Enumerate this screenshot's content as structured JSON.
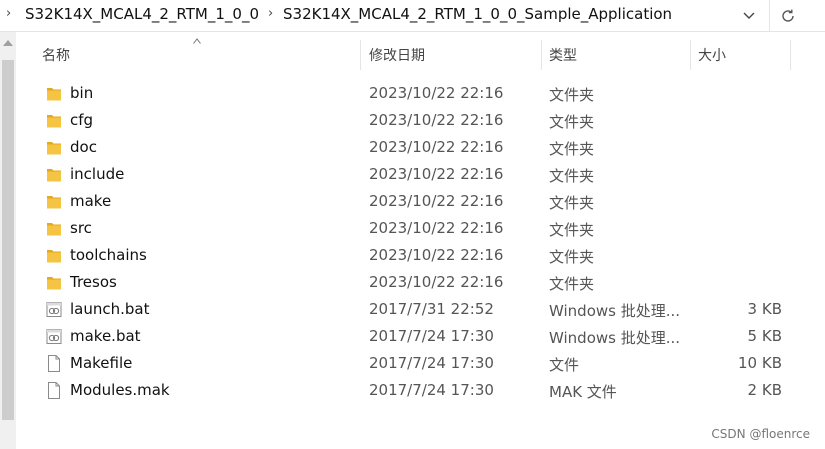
{
  "breadcrumb": {
    "items": [
      "S32K14X_MCAL4_2_RTM_1_0_0",
      "S32K14X_MCAL4_2_RTM_1_0_0_Sample_Application"
    ]
  },
  "columns": {
    "name": "名称",
    "date": "修改日期",
    "type": "类型",
    "size": "大小"
  },
  "files": [
    {
      "name": "bin",
      "date": "2023/10/22 22:16",
      "type": "文件夹",
      "size": "",
      "icon": "folder-icon"
    },
    {
      "name": "cfg",
      "date": "2023/10/22 22:16",
      "type": "文件夹",
      "size": "",
      "icon": "folder-icon"
    },
    {
      "name": "doc",
      "date": "2023/10/22 22:16",
      "type": "文件夹",
      "size": "",
      "icon": "folder-icon"
    },
    {
      "name": "include",
      "date": "2023/10/22 22:16",
      "type": "文件夹",
      "size": "",
      "icon": "folder-icon"
    },
    {
      "name": "make",
      "date": "2023/10/22 22:16",
      "type": "文件夹",
      "size": "",
      "icon": "folder-icon"
    },
    {
      "name": "src",
      "date": "2023/10/22 22:16",
      "type": "文件夹",
      "size": "",
      "icon": "folder-icon"
    },
    {
      "name": "toolchains",
      "date": "2023/10/22 22:16",
      "type": "文件夹",
      "size": "",
      "icon": "folder-icon"
    },
    {
      "name": "Tresos",
      "date": "2023/10/22 22:16",
      "type": "文件夹",
      "size": "",
      "icon": "folder-icon"
    },
    {
      "name": "launch.bat",
      "date": "2017/7/31 22:52",
      "type": "Windows 批处理...",
      "size": "3 KB",
      "icon": "batch-file-icon"
    },
    {
      "name": "make.bat",
      "date": "2017/7/24 17:30",
      "type": "Windows 批处理...",
      "size": "5 KB",
      "icon": "batch-file-icon"
    },
    {
      "name": "Makefile",
      "date": "2017/7/24 17:30",
      "type": "文件",
      "size": "10 KB",
      "icon": "file-icon"
    },
    {
      "name": "Modules.mak",
      "date": "2017/7/24 17:30",
      "type": "MAK 文件",
      "size": "2 KB",
      "icon": "file-icon"
    }
  ],
  "watermark": "CSDN @floenrce",
  "colors": {
    "folder": "#f5c443",
    "folder_dark": "#e3a922"
  }
}
